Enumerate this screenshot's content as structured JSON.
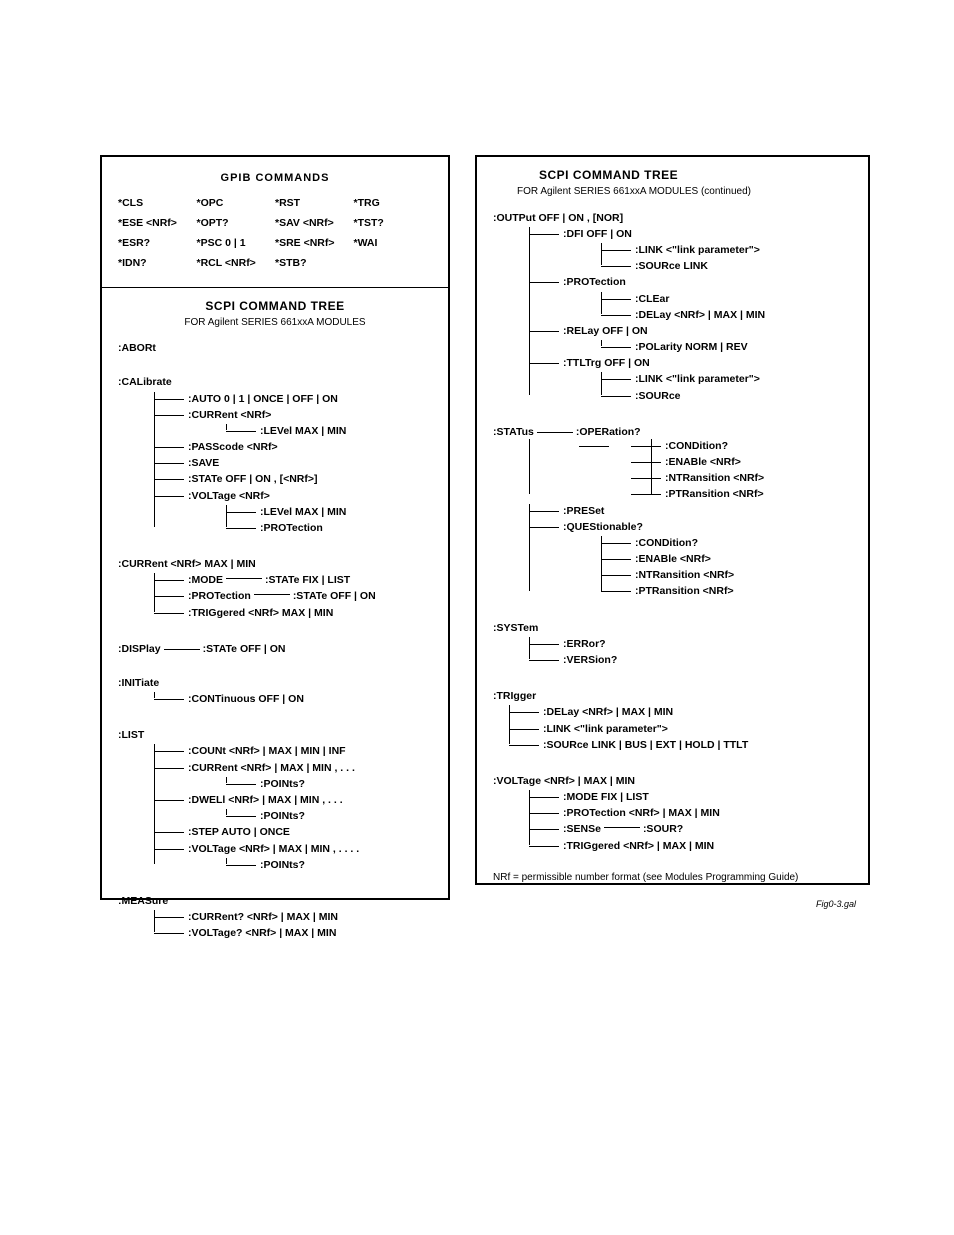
{
  "left": {
    "gpib_title": "GPIB  COMMANDS",
    "gpib": [
      "*CLS",
      "*OPC",
      "*RST",
      "*TRG",
      "*ESE <NRf>",
      "*OPT?",
      "*SAV <NRf>",
      "*TST?",
      "*ESR?",
      "*PSC 0 | 1",
      "*SRE <NRf>",
      "*WAI",
      "*IDN?",
      "*RCL <NRf>",
      "*STB?",
      ""
    ],
    "scpi_title": "SCPI COMMAND TREE",
    "scpi_sub": "FOR  Agilent  SERIES 661xxA MODULES",
    "abort": ":ABORt",
    "calibrate": ":CALibrate",
    "cal": {
      "auto": ":AUTO  0 | 1 | ONCE | OFF | ON",
      "current": ":CURRent  <NRf>",
      "level": ":LEVel  MAX | MIN",
      "passcode": ":PASScode  <NRf>",
      "save": ":SAVE",
      "state": ":STATe  OFF | ON , [<NRf>]",
      "voltage": ":VOLTage  <NRf>",
      "vlevel": ":LEVel  MAX | MIN",
      "vprot": ":PROTection"
    },
    "current": ":CURRent <NRf> MAX | MIN",
    "cur": {
      "mode": ":MODE",
      "mode_state": ":STATe  FIX | LIST",
      "prot": ":PROTection",
      "prot_state": ":STATe  OFF | ON",
      "trig": ":TRIGgered <NRf> MAX | MIN"
    },
    "display": ":DISPlay",
    "display_state": ":STATe  OFF | ON",
    "initiate": ":INITiate",
    "initiate_cont": ":CONTinuous  OFF | ON",
    "list": ":LIST",
    "li": {
      "count": ":COUNt  <NRf> | MAX | MIN | INF",
      "current": ":CURRent  <NRf> | MAX | MIN ,  . . .",
      "points": ":POINts?",
      "dwell": ":DWELl  <NRf> | MAX | MIN , . . .",
      "step": ":STEP  AUTO | ONCE",
      "voltage": ":VOLTage  <NRf> | MAX | MIN , . . . ."
    },
    "measure": ":MEASure",
    "meas": {
      "current": ":CURRent?  <NRf> | MAX | MIN",
      "voltage": ":VOLTage?  <NRf> | MAX | MIN"
    }
  },
  "right": {
    "scpi_title": "SCPI COMMAND TREE",
    "scpi_sub": "FOR  Agilent SERIES 661xxA MODULES   (continued)",
    "output": ":OUTPut  OFF | ON , [NOR]",
    "out": {
      "dfi": ":DFI  OFF | ON",
      "link": ":LINK  <\"link parameter\">",
      "source": ":SOURce  LINK",
      "prot": ":PROTection",
      "clear": ":CLEar",
      "delay": ":DELay  <NRf> | MAX | MIN",
      "relay": ":RELay  OFF | ON",
      "polarity": ":POLarity  NORM | REV",
      "ttltrg": ":TTLTrg  OFF | ON",
      "ttl_link": ":LINK  <\"link parameter\">",
      "ttl_source": ":SOURce"
    },
    "status": ":STATus",
    "stat": {
      "operation": ":OPERation?",
      "cond": ":CONDition?",
      "enable": ":ENABle  <NRf>",
      "ntr": ":NTRansition  <NRf>",
      "ptr": ":PTRansition  <NRf>",
      "preset": ":PRESet",
      "quest": ":QUEStionable?"
    },
    "system": ":SYSTem",
    "sys": {
      "error": ":ERRor?",
      "version": ":VERSion?"
    },
    "trigger": ":TRIgger",
    "trig": {
      "delay": ":DELay  <NRf> | MAX | MIN",
      "link": ":LINK  <\"link parameter\">",
      "source": ":SOURce  LINK | BUS | EXT | HOLD | TTLT"
    },
    "voltage": ":VOLTage  <NRf> | MAX | MIN",
    "volt": {
      "mode": ":MODE  FIX | LIST",
      "prot": ":PROTection  <NRf> | MAX | MIN",
      "sense": ":SENSe",
      "sour": ":SOUR?",
      "trig": ":TRIGgered  <NRf> | MAX | MIN"
    },
    "footnote": "NRf = permissible number format (see Modules Programming Guide)",
    "figref": "Fig0-3.gal"
  }
}
